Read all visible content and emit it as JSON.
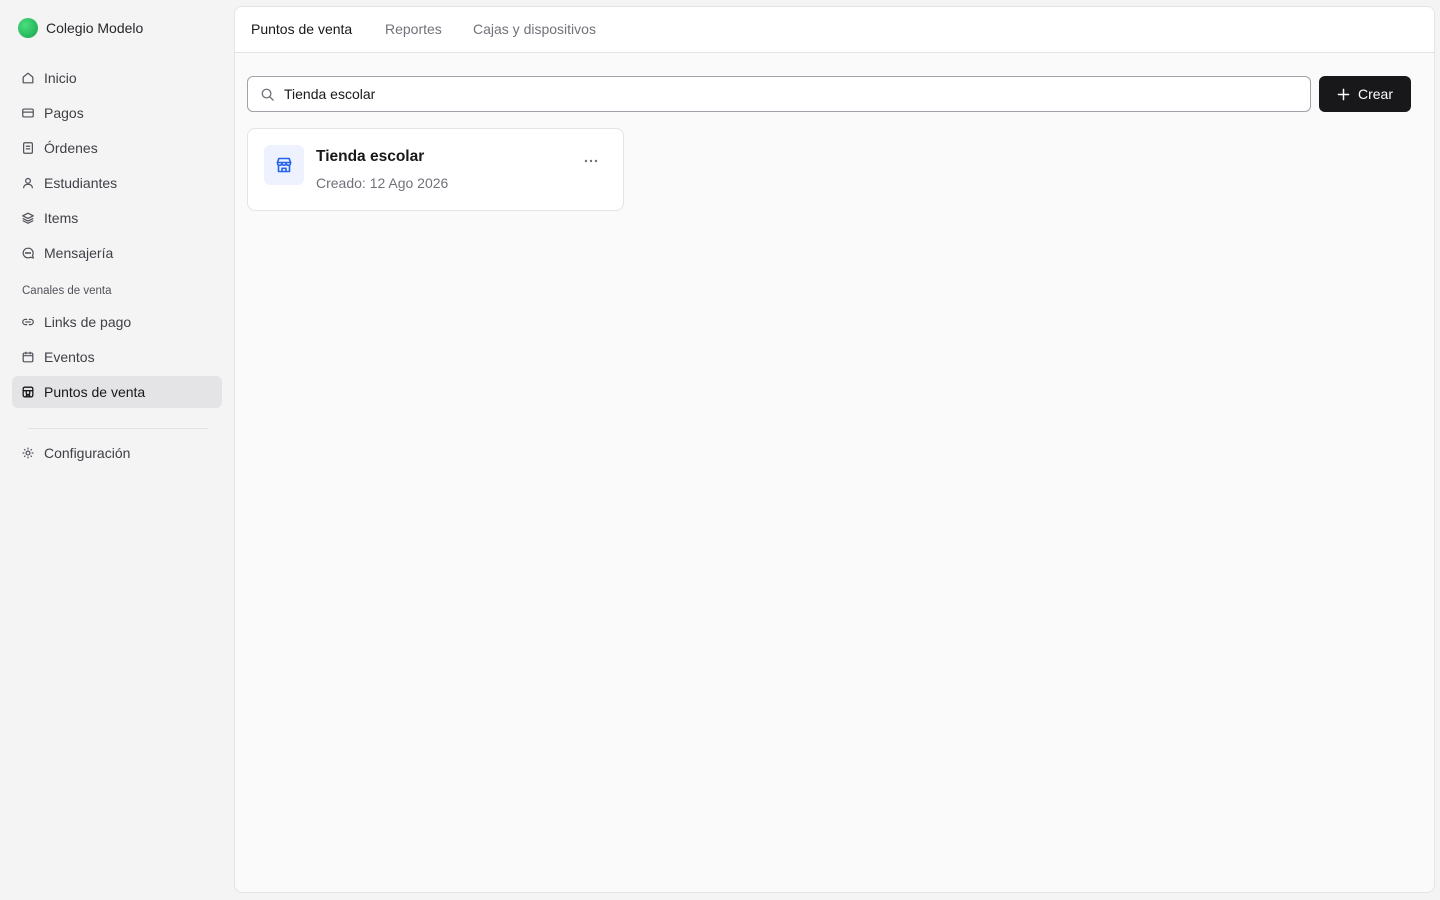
{
  "org": {
    "name": "Colegio Modelo"
  },
  "sidebar": {
    "items": [
      {
        "label": "Inicio",
        "icon": "home-icon"
      },
      {
        "label": "Pagos",
        "icon": "credit-card-icon"
      },
      {
        "label": "Órdenes",
        "icon": "receipt-icon"
      },
      {
        "label": "Estudiantes",
        "icon": "user-icon"
      },
      {
        "label": "Items",
        "icon": "layers-icon"
      },
      {
        "label": "Mensajería",
        "icon": "message-icon"
      }
    ],
    "section_label": "Canales de venta",
    "channels": [
      {
        "label": "Links de pago",
        "icon": "link-icon"
      },
      {
        "label": "Eventos",
        "icon": "calendar-icon"
      },
      {
        "label": "Puntos de venta",
        "icon": "store-icon",
        "active": true
      }
    ],
    "settings": {
      "label": "Configuración",
      "icon": "gear-icon"
    }
  },
  "tabs": [
    {
      "label": "Puntos de venta",
      "active": true
    },
    {
      "label": "Reportes"
    },
    {
      "label": "Cajas y dispositivos"
    }
  ],
  "search": {
    "value": "Tienda escolar",
    "placeholder": ""
  },
  "actions": {
    "create_label": "Crear"
  },
  "cards": [
    {
      "title": "Tienda escolar",
      "subtitle": "Creado: 12 Ago 2026",
      "icon": "store-icon"
    }
  ],
  "colors": {
    "accent": "#18181b",
    "brand_logo": "#22c55e",
    "store_icon": "#2563eb",
    "active_nav_bg": "#e4e4e7"
  }
}
